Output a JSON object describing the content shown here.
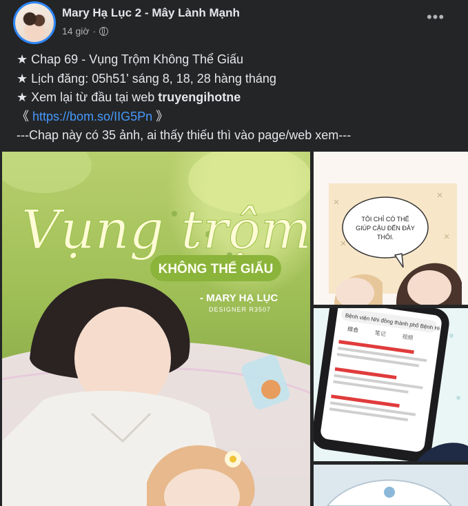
{
  "post": {
    "author": "Mary Hạ Lục 2 - Mây Lành Mạnh",
    "time": "14 giờ",
    "dot": "·",
    "more": "•••",
    "lines": {
      "l1": "★ Chap 69 - Vụng Trộm Không Thể Giấu",
      "l2": "★ Lịch đăng: 05h51' sáng 8, 18, 28 hàng tháng",
      "l3_prefix": "★ Xem lại từ đầu tại web ",
      "l3_bold": "truyengihotne",
      "l4_open": "《 ",
      "l4_link": "https://bom.so/IIG5Pn",
      "l4_close": " 》",
      "l5": "---Chap này có 35 ảnh, ai thấy thiếu thì vào page/web xem---"
    }
  },
  "images": {
    "cover": {
      "title": "Vụng trộm",
      "subtitle": "KHÔNG THỂ GIẤU",
      "author": "- MARY HẠ LỤC",
      "designer": "DESIGNER R3507"
    },
    "panel1": {
      "bubble_l1": "TÔI CHỈ CÓ THỂ",
      "bubble_l2": "GIÚP CẬU ĐẾN ĐÂY",
      "bubble_l3": "THÔI."
    },
    "panel2": {
      "phone_title": "Bệnh viện Nhi đồng thành phố Bệnh Hi",
      "tab1": "综合",
      "tab2": "笔记",
      "tab3": "视频"
    }
  },
  "colors": {
    "background": "#242526",
    "link": "#4599ff",
    "accent_ring": "#2d88ff",
    "muted": "#b0b3b8"
  }
}
